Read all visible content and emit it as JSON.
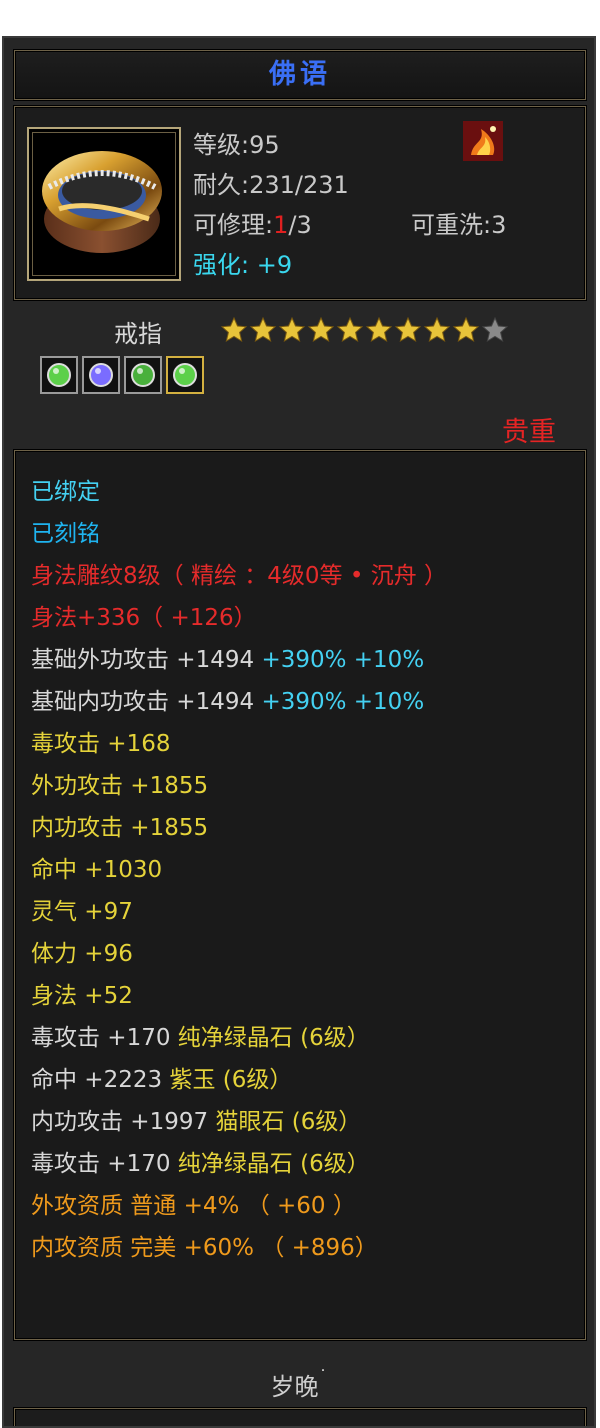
{
  "item": {
    "name": "佛语",
    "level_label": "等级",
    "level": "95",
    "durability_label": "耐久",
    "durability": "231/231",
    "repair_label": "可修理",
    "repair_used": "1",
    "repair_total": "/3",
    "rewash_label": "可重洗",
    "rewash": "3",
    "enhance_label": "强化",
    "enhance": "+9",
    "type": "戒指",
    "stars_filled": 9,
    "stars_total": 10,
    "quality": "贵重"
  },
  "gems": [
    {
      "icon": "green-gem-icon",
      "color": "#5cd04a"
    },
    {
      "icon": "purple-gem-icon",
      "color": "#7a6cff"
    },
    {
      "icon": "green-gem-icon",
      "color": "#49b03c"
    },
    {
      "icon": "green-gem-icon",
      "color": "#5cd04a"
    }
  ],
  "attributes": [
    {
      "parts": [
        {
          "text": "已绑定",
          "color": "c-cyan"
        }
      ]
    },
    {
      "parts": [
        {
          "text": "已刻铭",
          "color": "c-cyan2"
        }
      ]
    },
    {
      "parts": [
        {
          "text": "身法雕纹8级（ 精绘 ：4级0等 • 沉舟 ）",
          "color": "c-red"
        }
      ]
    },
    {
      "parts": [
        {
          "text": "身法+336（ +126）",
          "color": "c-red"
        }
      ]
    },
    {
      "parts": [
        {
          "text": "基础外功攻击 +1494 ",
          "color": "c-white"
        },
        {
          "text": "+390% +10%",
          "color": "c-cyan"
        }
      ]
    },
    {
      "parts": [
        {
          "text": "基础内功攻击 +1494 ",
          "color": "c-white"
        },
        {
          "text": "+390% +10%",
          "color": "c-cyan"
        }
      ]
    },
    {
      "parts": [
        {
          "text": "毒攻击 +168",
          "color": "c-yellow"
        }
      ]
    },
    {
      "parts": [
        {
          "text": "外功攻击 +1855",
          "color": "c-yellow"
        }
      ]
    },
    {
      "parts": [
        {
          "text": "内功攻击 +1855",
          "color": "c-yellow"
        }
      ]
    },
    {
      "parts": [
        {
          "text": "命中 +1030",
          "color": "c-yellow"
        }
      ]
    },
    {
      "parts": [
        {
          "text": "灵气 +97",
          "color": "c-yellow"
        }
      ]
    },
    {
      "parts": [
        {
          "text": "体力 +96",
          "color": "c-yellow"
        }
      ]
    },
    {
      "parts": [
        {
          "text": "身法 +52",
          "color": "c-yellow"
        }
      ]
    },
    {
      "parts": [
        {
          "text": "毒攻击 +170 ",
          "color": "c-white"
        },
        {
          "text": "纯净绿晶石 (6级）",
          "color": "c-yellow"
        }
      ]
    },
    {
      "parts": [
        {
          "text": "命中 +2223 ",
          "color": "c-white"
        },
        {
          "text": "紫玉 (6级）",
          "color": "c-yellow"
        }
      ]
    },
    {
      "parts": [
        {
          "text": "内功攻击 +1997 ",
          "color": "c-white"
        },
        {
          "text": "猫眼石 (6级）",
          "color": "c-yellow"
        }
      ]
    },
    {
      "parts": [
        {
          "text": "毒攻击 +170 ",
          "color": "c-white"
        },
        {
          "text": "纯净绿晶石 (6级）",
          "color": "c-yellow"
        }
      ]
    },
    {
      "parts": [
        {
          "text": "外攻资质  普通 +4% （ +60 ）",
          "color": "c-orange"
        }
      ]
    },
    {
      "parts": [
        {
          "text": "内攻资质  完美 +60% （ +896）",
          "color": "c-orange"
        }
      ]
    }
  ],
  "footer": {
    "maker": "岁晚",
    "mark": "˙"
  },
  "colors": {
    "star_gold": "#e8c43a",
    "star_empty": "#8a8a8a"
  }
}
